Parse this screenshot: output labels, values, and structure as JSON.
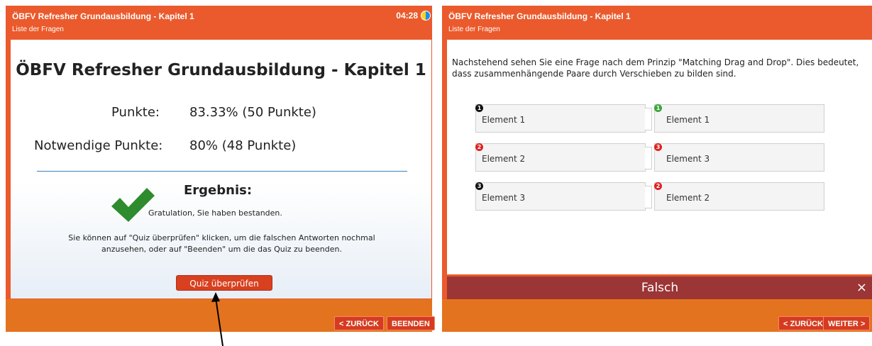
{
  "left": {
    "header_title": "ÖBFV Refresher Grundausbildung - Kapitel 1",
    "header_sub": "Liste der Fragen",
    "timer": "04:28",
    "big_title": "ÖBFV Refresher Grundausbildung - Kapitel 1",
    "punkte_label": "Punkte:",
    "punkte_value": "83.33% (50 Punkte)",
    "notwendig_label": "Notwendige Punkte:",
    "notwendig_value": "80% (48 Punkte)",
    "result_title": "Ergebnis:",
    "result_text": "Gratulation, Sie haben bestanden.",
    "info_line1": "Sie können auf \"Quiz überprüfen\" klicken, um die falschen Antworten nochmal",
    "info_line2": "anzusehen, oder auf \"Beenden\" um die das Quiz zu beenden.",
    "quiz_button": "Quiz überprüfen",
    "back_button": "< ZURÜCK",
    "end_button": "BEENDEN"
  },
  "right": {
    "header_title": "ÖBFV Refresher Grundausbildung - Kapitel 1",
    "header_sub": "Liste der Fragen",
    "intro": "Nachstehend sehen Sie eine Frage nach dem Prinzip \"Matching Drag and Drop\". Dies bedeutet, dass zusammenhängende Paare durch Verschieben zu bilden sind.",
    "left_items": [
      {
        "num": "1",
        "label": "Element 1",
        "color": "black"
      },
      {
        "num": "2",
        "label": "Element 2",
        "color": "red"
      },
      {
        "num": "3",
        "label": "Element 3",
        "color": "black"
      }
    ],
    "right_items": [
      {
        "num": "1",
        "label": "Element 1",
        "color": "green"
      },
      {
        "num": "3",
        "label": "Element 3",
        "color": "red"
      },
      {
        "num": "2",
        "label": "Element 2",
        "color": "red"
      }
    ],
    "feedback": "Falsch",
    "close": "×",
    "back_button": "< ZURÜCK",
    "next_button": "WEITER >"
  },
  "colors": {
    "accent": "#ea5a2c",
    "bottom_bar": "#e4731f",
    "button": "#d63b1f",
    "feedback_bar": "#9c3535",
    "check": "#2e8b2e"
  }
}
